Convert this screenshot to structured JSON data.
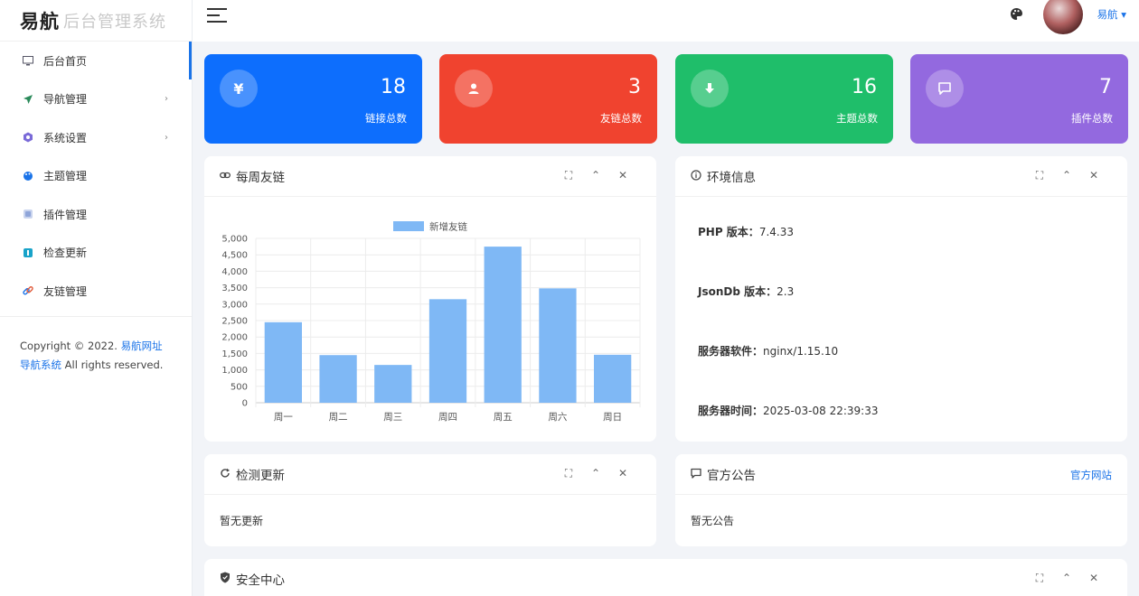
{
  "logo": {
    "brand": "易航",
    "subtitle": "后台管理系统"
  },
  "sidebar": {
    "items": [
      {
        "label": "后台首页",
        "icon": "monitor-icon",
        "active": true,
        "has_children": false
      },
      {
        "label": "导航管理",
        "icon": "send-icon",
        "active": false,
        "has_children": true
      },
      {
        "label": "系统设置",
        "icon": "settings-hex-icon",
        "active": false,
        "has_children": true
      },
      {
        "label": "主题管理",
        "icon": "palette-icon",
        "active": false,
        "has_children": false
      },
      {
        "label": "插件管理",
        "icon": "plugin-icon",
        "active": false,
        "has_children": false
      },
      {
        "label": "检查更新",
        "icon": "update-icon",
        "active": false,
        "has_children": false
      },
      {
        "label": "友链管理",
        "icon": "link-icon",
        "active": false,
        "has_children": false
      }
    ],
    "copyright_prefix": "Copyright © 2022.",
    "copyright_link": "易航网址导航系统",
    "copyright_suffix": "All rights reserved."
  },
  "topbar": {
    "user_name": "易航 ▾"
  },
  "stats": [
    {
      "value": "18",
      "label": "链接总数",
      "icon": "yen-icon",
      "color": "#0d6efd"
    },
    {
      "value": "3",
      "label": "友链总数",
      "icon": "user-icon",
      "color": "#f0432f"
    },
    {
      "value": "16",
      "label": "主题总数",
      "icon": "download-icon",
      "color": "#1fbe6a"
    },
    {
      "value": "7",
      "label": "插件总数",
      "icon": "message-icon",
      "color": "#9369df"
    }
  ],
  "panels": {
    "weekly": {
      "title": "每周友链"
    },
    "env": {
      "title": "环境信息",
      "rows": [
        {
          "key": "PHP 版本：",
          "value": "7.4.33"
        },
        {
          "key": "JsonDb 版本：",
          "value": "2.3"
        },
        {
          "key": "服务器软件：",
          "value": "nginx/1.15.10"
        },
        {
          "key": "服务器时间：",
          "value": "2025-03-08 22:39:33"
        }
      ]
    },
    "update": {
      "title": "检测更新",
      "body": "暂无更新"
    },
    "notice": {
      "title": "官方公告",
      "link": "官方网站",
      "body": "暂无公告"
    },
    "security": {
      "title": "安全中心"
    }
  },
  "chart_data": {
    "type": "bar",
    "categories": [
      "周一",
      "周二",
      "周三",
      "周四",
      "周五",
      "周六",
      "周日"
    ],
    "series": [
      {
        "name": "新增友链",
        "values": [
          2450,
          1450,
          1150,
          3150,
          4750,
          3480,
          1460
        ]
      }
    ],
    "ylim": [
      0,
      5000
    ],
    "yticks": [
      "0",
      "500",
      "1,000",
      "1,500",
      "2,000",
      "2,500",
      "3,000",
      "3,500",
      "4,000",
      "4,500",
      "5,000"
    ],
    "legend": "top",
    "grid": true,
    "bar_color": "#7fb8f5"
  }
}
